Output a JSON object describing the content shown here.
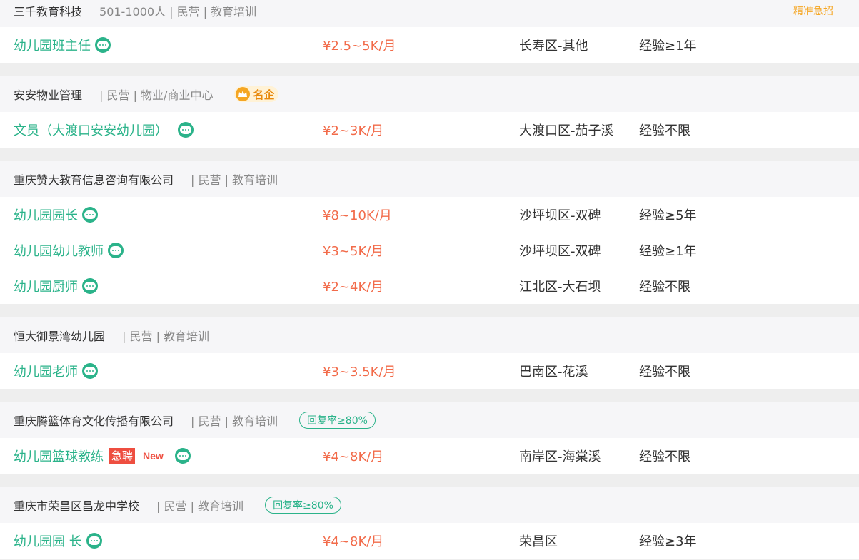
{
  "blocks": [
    {
      "company": "三千教育科技",
      "meta": "501-1000人 | 民营 | 教育培训",
      "badge_top_right": "精准急招",
      "jobs": [
        {
          "title": "幼儿园班主任",
          "salary": "¥2.5~5K/月",
          "location": "长寿区-其他",
          "experience": "经验≥1年"
        }
      ]
    },
    {
      "company": "安安物业管理",
      "meta": "| 民营 | 物业/商业中心",
      "famous_badge": "名企",
      "jobs": [
        {
          "title": "文员（大渡口安安幼儿园）",
          "salary": "¥2~3K/月",
          "location": "大渡口区-茄子溪",
          "experience": "经验不限"
        }
      ]
    },
    {
      "company": "重庆赞大教育信息咨询有限公司",
      "meta": "| 民营 | 教育培训",
      "jobs": [
        {
          "title": "幼儿园园长",
          "salary": "¥8~10K/月",
          "location": "沙坪坝区-双碑",
          "experience": "经验≥5年"
        },
        {
          "title": "幼儿园幼儿教师",
          "salary": "¥3~5K/月",
          "location": "沙坪坝区-双碑",
          "experience": "经验≥1年"
        },
        {
          "title": "幼儿园厨师",
          "salary": "¥2~4K/月",
          "location": "江北区-大石坝",
          "experience": "经验不限"
        }
      ]
    },
    {
      "company": "恒大御景湾幼儿园",
      "meta": "| 民营 | 教育培训",
      "jobs": [
        {
          "title": "幼儿园老师",
          "salary": "¥3~3.5K/月",
          "location": "巴南区-花溪",
          "experience": "经验不限"
        }
      ]
    },
    {
      "company": "重庆腾篮体育文化传播有限公司",
      "meta": "| 民营 | 教育培训",
      "reply_badge": "回复率≥80%",
      "jobs": [
        {
          "title": "幼儿园篮球教练",
          "urgent_tag": "急聘",
          "new_tag": "New",
          "salary": "¥4~8K/月",
          "location": "南岸区-海棠溪",
          "experience": "经验不限"
        }
      ]
    },
    {
      "company": "重庆市荣昌区昌龙中学校",
      "meta": "| 民营 | 教育培训",
      "reply_badge": "回复率≥80%",
      "jobs": [
        {
          "title": "幼儿园园 长",
          "salary": "¥4~8K/月",
          "location": "荣昌区",
          "experience": "经验≥3年"
        }
      ]
    }
  ],
  "icons": {
    "chat": "chat-bubble-icon",
    "crown": "crown-icon"
  },
  "colors": {
    "green": "#2bb38a",
    "salary": "#f26b4a",
    "urgent": "#ee4e40",
    "orange": "#f5a623"
  }
}
